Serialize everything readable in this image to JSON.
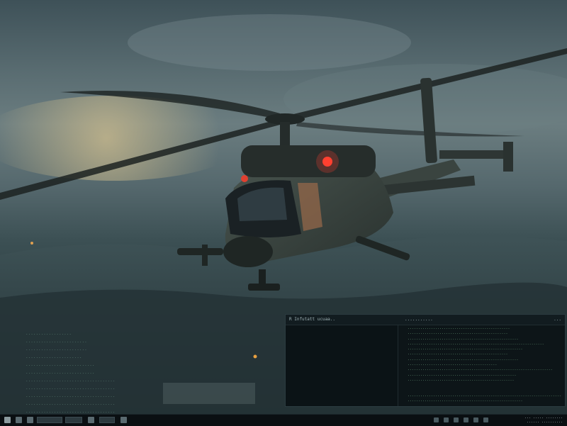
{
  "wallpaper": {
    "subject": "helicopter-in-flight-over-city"
  },
  "desktop_list": {
    "items": [
      "..................",
      "........................",
      "........................",
      "......................",
      "...........................",
      "...........................",
      "...................................",
      "...................................",
      "...................................",
      "...................................",
      "...................................",
      "..........................."
    ]
  },
  "terminal": {
    "title_left": "R Infutatt ucuaa..",
    "title_mid": "...........",
    "title_right": "...",
    "lines": [
      "................................................",
      "...............................................",
      "....................................................",
      "................................................................",
      "......................................................",
      "...............................................",
      "....................................................",
      "..........................................",
      "....................................................................",
      "...................................................",
      "..................................................",
      "",
      "",
      ".........................................................................",
      "......................................................"
    ]
  },
  "taskbar": {
    "time_line1": "... ..... ........",
    "time_line2": "...... .........."
  }
}
